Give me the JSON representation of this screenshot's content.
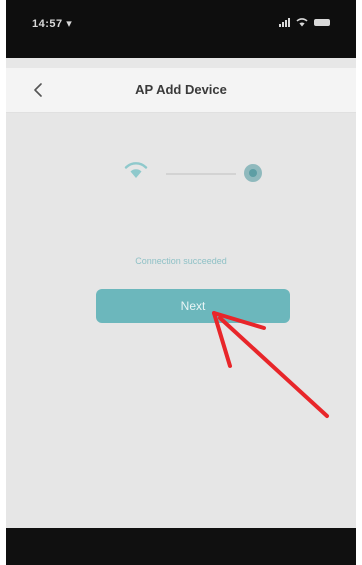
{
  "status_bar": {
    "time": "14:57 ▾"
  },
  "nav": {
    "back_icon": "chevron-left-icon",
    "title": "AP Add Device"
  },
  "connection": {
    "wifi_icon": "wifi-icon",
    "device_icon": "device-icon",
    "message": "Connection succeeded"
  },
  "next_button": {
    "label": "Next"
  },
  "colors": {
    "accent": "#6cb7bc",
    "arrow": "#e8262a",
    "status_bar": "#0e0e0e",
    "background": "#e6e6e6"
  }
}
